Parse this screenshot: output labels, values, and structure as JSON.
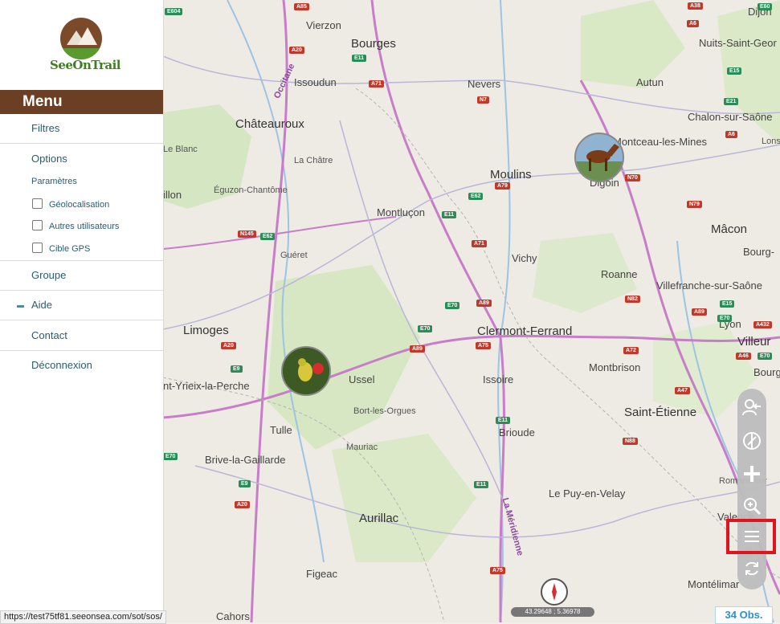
{
  "brand": {
    "name": "SeeOnTrail"
  },
  "menu": {
    "title": "Menu",
    "items": [
      {
        "label": "Filtres"
      },
      {
        "label": "Options"
      },
      {
        "label": "Groupe"
      },
      {
        "label": "Aide"
      },
      {
        "label": "Contact"
      },
      {
        "label": "Déconnexion"
      }
    ],
    "parameters_title": "Paramètres",
    "checkboxes": [
      {
        "label": "Géolocalisation",
        "checked": false
      },
      {
        "label": "Autres utilisateurs",
        "checked": false
      },
      {
        "label": "Cible GPS",
        "checked": false
      }
    ]
  },
  "map": {
    "cities": [
      "Vierzon",
      "Bourges",
      "Nevers",
      "Autun",
      "Dijon",
      "Nuits-Saint-Geor",
      "Issoudun",
      "Châteauroux",
      "Chalon-sur-Saône",
      "Le Blanc",
      "La Châtre",
      "Montceau-les-Mines",
      "Moulins",
      "Digoin",
      "Lons",
      "illon",
      "Éguzon-Chantôme",
      "Montluçon",
      "Mâcon",
      "Bourg-",
      "Guéret",
      "Vichy",
      "Roanne",
      "Villefranche-sur-Saône",
      "Limoges",
      "Clermont-Ferrand",
      "Lyon",
      "Villeur",
      "Ussel",
      "Issoire",
      "Montbrison",
      "nt-Yrieix-la-Perche",
      "Bourg",
      "Saint-Étienne",
      "Bort-les-Orgues",
      "Tulle",
      "Brioude",
      "Mauriac",
      "Brive-la-Gaillarde",
      "Romans-sur",
      "Le Puy-en-Velay",
      "Aurillac",
      "Valence",
      "Figeac",
      "Montélimar",
      "Cahors",
      "Occitane",
      "La Méridienne"
    ],
    "road_shields": [
      "E604",
      "A85",
      "A38",
      "E60",
      "A20",
      "E11",
      "A71",
      "N7",
      "A6",
      "E15",
      "E21",
      "A6",
      "A79",
      "N70",
      "N79",
      "E62",
      "E11",
      "A71",
      "N145",
      "E62",
      "A89",
      "N82",
      "E70",
      "E70",
      "A89",
      "A75",
      "A72",
      "E15",
      "E70",
      "A89",
      "A432",
      "A46",
      "E70",
      "A20",
      "E9",
      "A47",
      "E11",
      "N88",
      "E70",
      "E9",
      "A20",
      "E11",
      "A75"
    ],
    "coordinates": "43.29648 ; 5.36978",
    "observations": "34 Obs."
  },
  "status": {
    "url": "https://test75tf81.seeonsea.com/sot/sos/"
  }
}
